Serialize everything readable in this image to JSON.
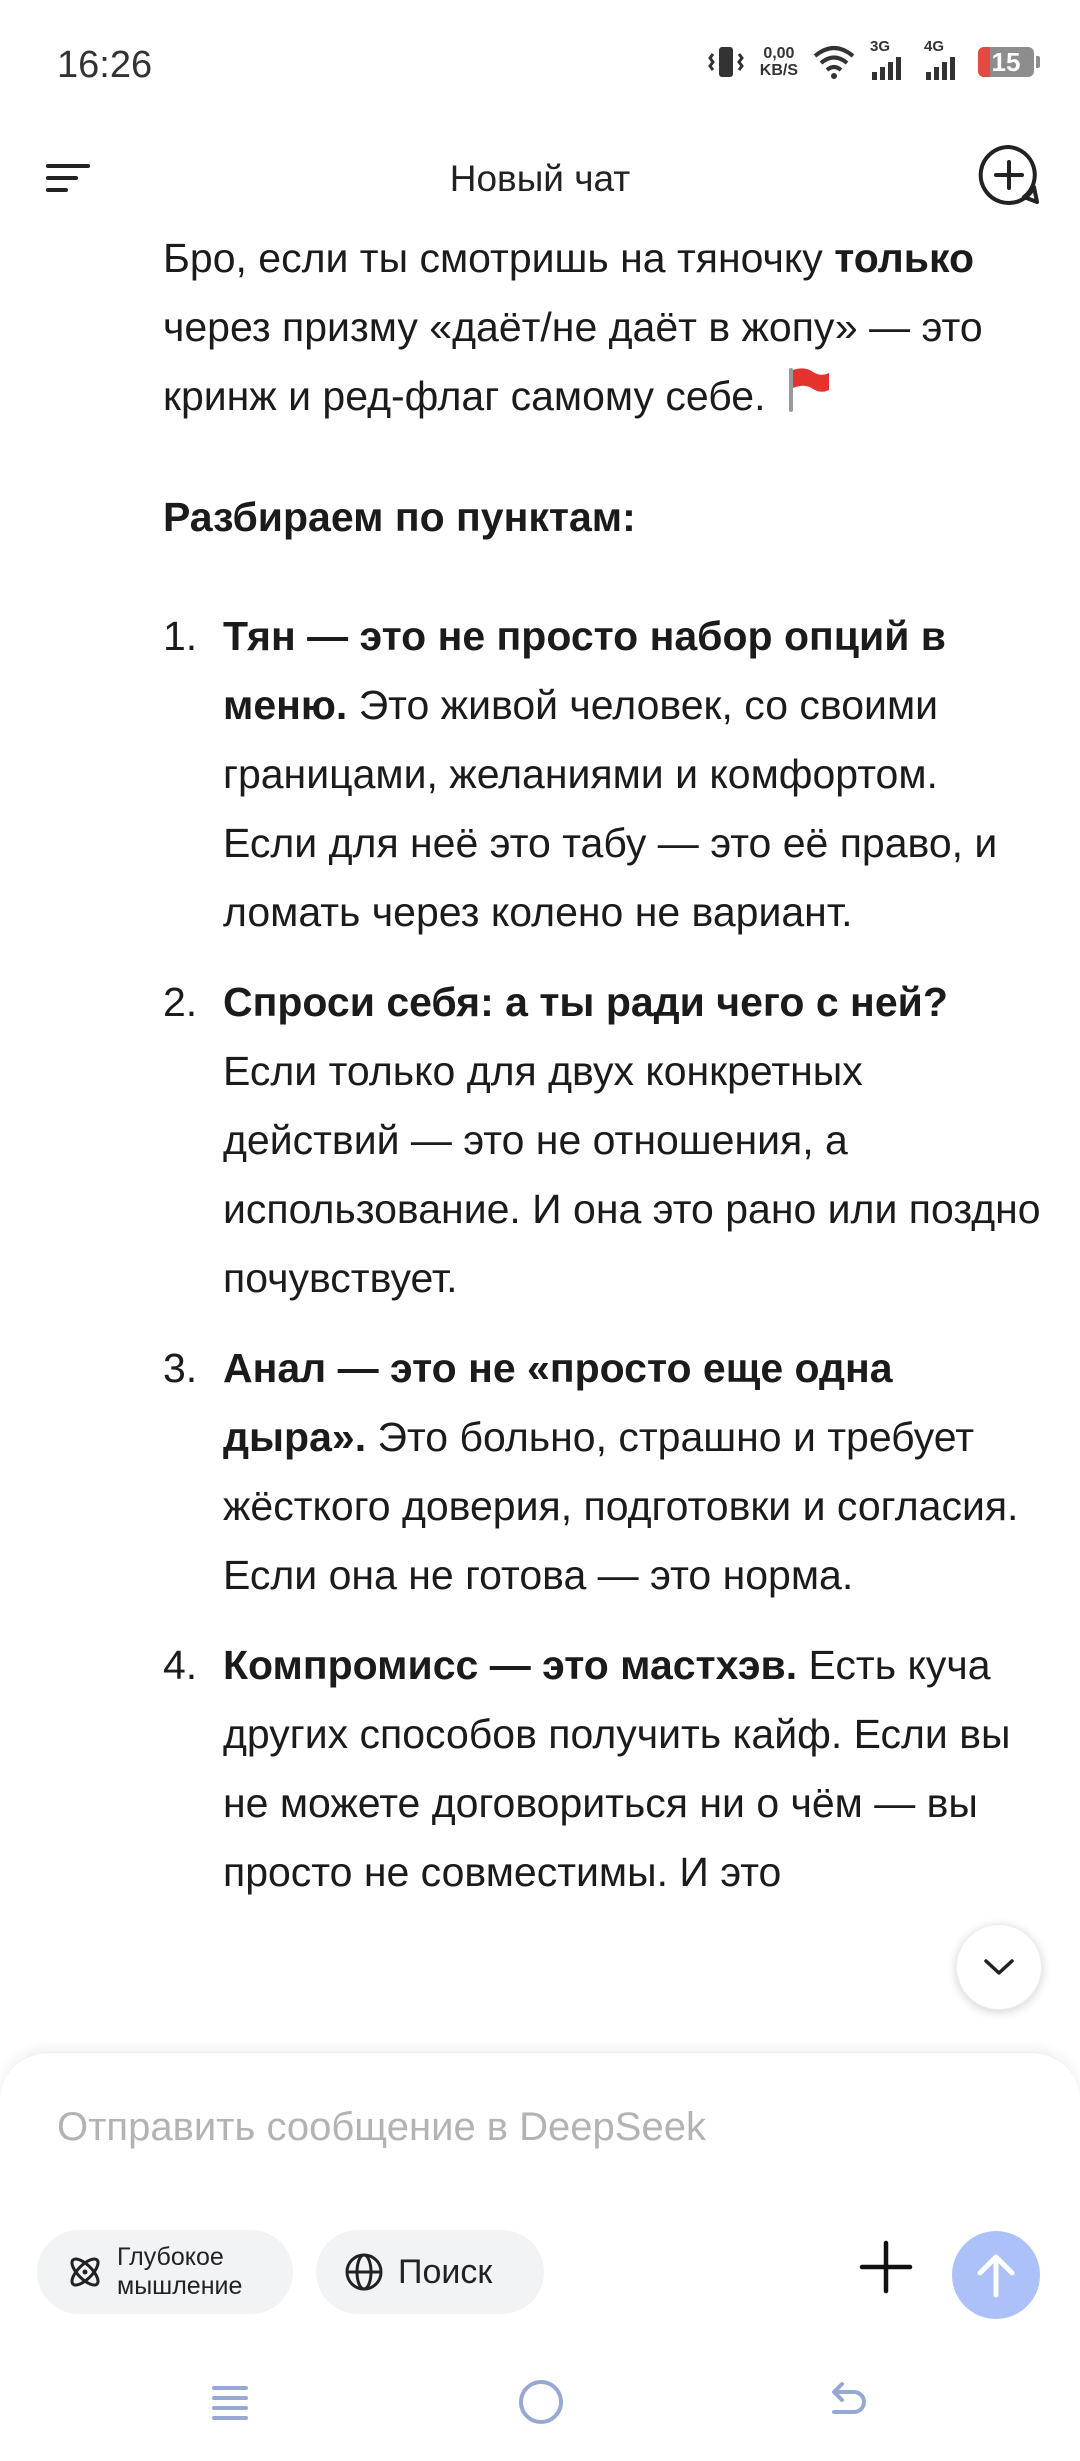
{
  "status_bar": {
    "time": "16:26",
    "net_speed_value": "0,00",
    "net_speed_unit": "KB/S",
    "sim1_label": "3G",
    "sim2_label": "4G",
    "battery": "15"
  },
  "header": {
    "title": "Новый чат"
  },
  "message": {
    "intro_1": "Бро, если ты смотришь на тяночку ",
    "intro_bold": "только",
    "intro_2": " через призму «даёт/не даёт в жопу» — это кринж и ред-флаг самому себе.",
    "heading": "Разбираем по пунктам:",
    "items": [
      {
        "num": "1.",
        "bold": "Тян — это не просто набор опций в меню.",
        "text": " Это живой человек, со своими границами, желаниями и комфортом. Если для неё это табу — это её право, и ломать через колено не вариант."
      },
      {
        "num": "2.",
        "bold": "Спроси себя: а ты ради чего с ней?",
        "text": " Если только для двух конкретных действий — это не отношения, а использование. И она это рано или поздно почувствует."
      },
      {
        "num": "3.",
        "bold": "Анал — это не «просто еще одна дыра».",
        "text": " Это больно, страшно и требует жёсткого доверия, подготовки и согласия. Если она не готова — это норма."
      },
      {
        "num": "4.",
        "bold": "Компромисс — это мастхэв.",
        "text": " Есть куча других способов получить кайф. Если вы не можете договориться ни о чём — вы просто не совместимы. И это"
      }
    ]
  },
  "composer": {
    "placeholder": "Отправить сообщение в DeepSeek",
    "deep_label_1": "Глубокое",
    "deep_label_2": "мышление",
    "search_label": "Поиск"
  },
  "colors": {
    "send_button": "#abc1f8",
    "nav_icons": "#98a8d4",
    "flag": "#e5322d"
  }
}
